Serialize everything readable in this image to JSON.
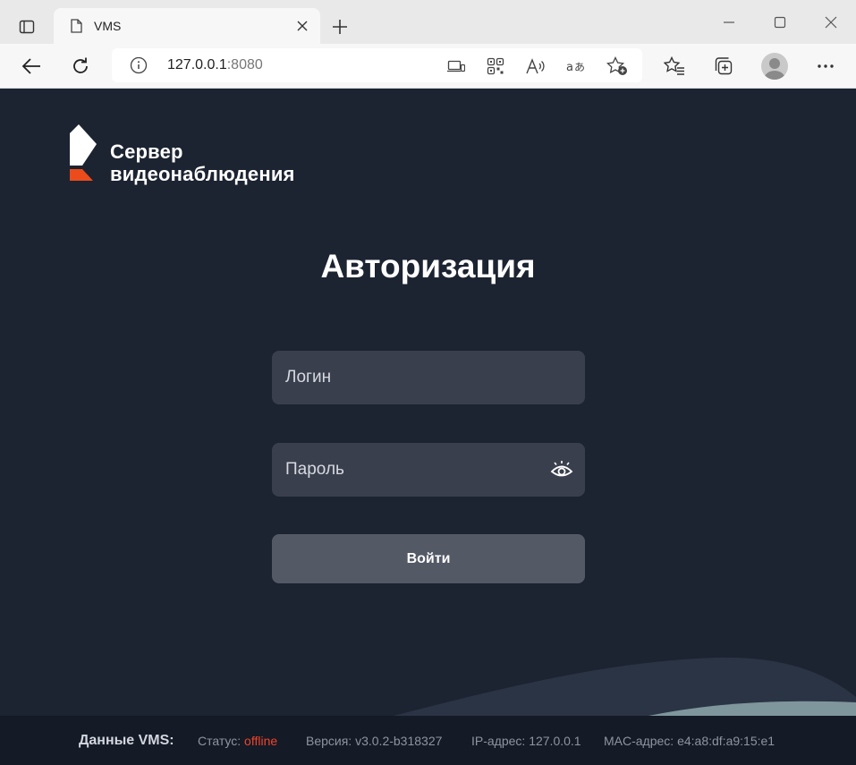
{
  "browser": {
    "tab": {
      "title": "VMS"
    },
    "address": {
      "host": "127.0.0.1",
      "port": ":8080"
    },
    "icons": [
      "tab-actions-icon",
      "page-icon",
      "close-icon",
      "plus-icon",
      "minimize-icon",
      "maximize-icon",
      "window-close-icon",
      "back-icon",
      "refresh-icon",
      "info-icon",
      "app-available-icon",
      "qr-code-icon",
      "read-aloud-icon",
      "translate-icon",
      "add-favorite-icon",
      "favorites-icon",
      "collections-icon",
      "profile-avatar",
      "more-icon"
    ]
  },
  "page": {
    "logo": {
      "line1": "Сервер",
      "line2": "видеонаблюдения"
    },
    "title": "Авторизация",
    "login": {
      "placeholder": "Логин",
      "value": ""
    },
    "password": {
      "placeholder": "Пароль",
      "value": ""
    },
    "submit_label": "Войти"
  },
  "footer": {
    "label": "Данные VMS:",
    "status_label": "Статус:",
    "status_value": "offline",
    "version": "Версия: v3.0.2-b318327",
    "ip": "IP-адрес: 127.0.0.1",
    "mac": "MAC-адрес: e4:a8:df:a9:15:e1"
  },
  "colors": {
    "background": "#1c2331",
    "field": "#3a3f4e",
    "button": "#545966",
    "accent": "#f0442a",
    "footer": "#141a26"
  }
}
